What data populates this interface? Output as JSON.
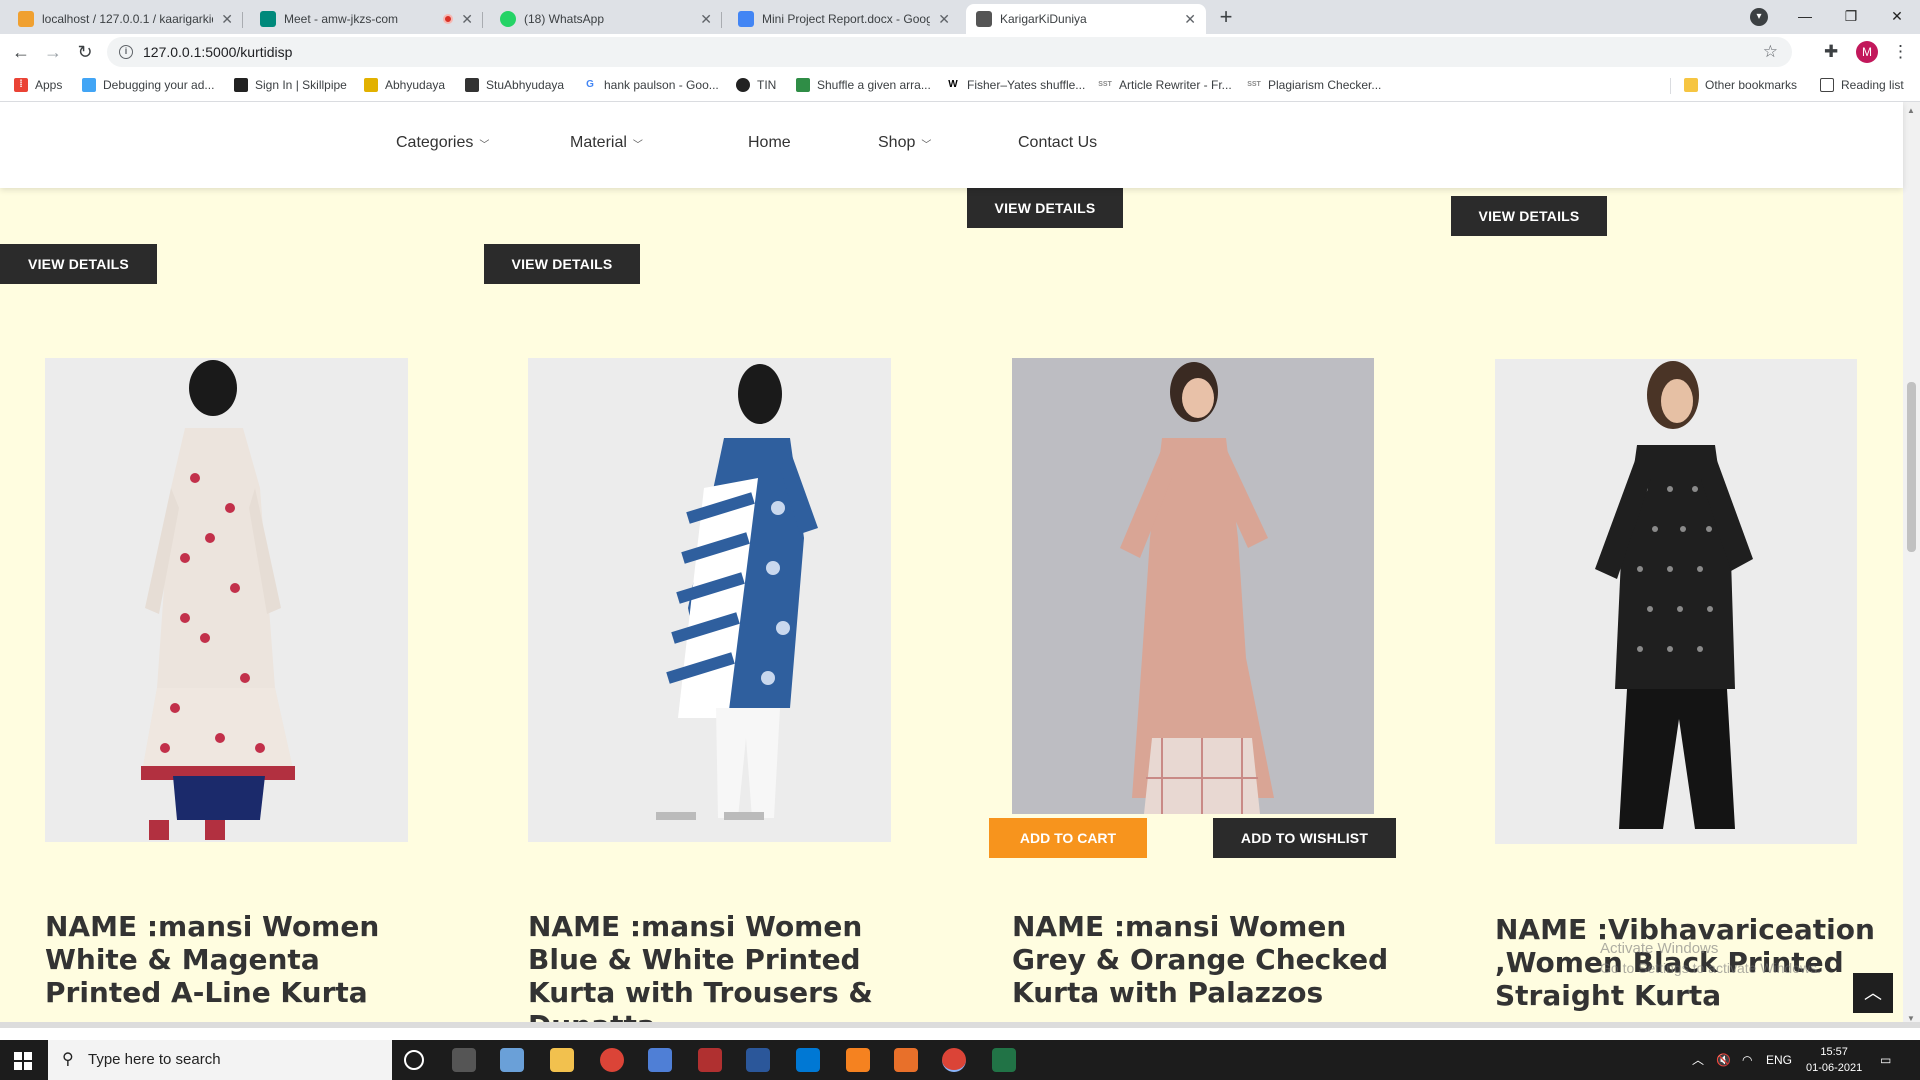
{
  "browser": {
    "tabs": [
      {
        "title": "localhost / 127.0.0.1 / kaarigarkiduniya",
        "favicon_color": "#f0a030"
      },
      {
        "title": "Meet - amw-jkzs-com",
        "favicon_color": "#00897b"
      },
      {
        "title": "(18) WhatsApp",
        "favicon_color": "#25d366"
      },
      {
        "title": "Mini Project Report.docx - Google Docs",
        "favicon_color": "#4285f4"
      },
      {
        "title": "KarigarKiDuniya",
        "favicon_color": "#555555"
      }
    ],
    "url": "127.0.0.1:5000/kurtidisp",
    "profile_initial": "M",
    "bookmarks": [
      "Apps",
      "Debugging your ad...",
      "Sign In | Skillpipe",
      "Abhyudaya",
      "StuAbhyudaya",
      "hank paulson - Goo...",
      "TIN",
      "Shuffle a given arra...",
      "Fisher–Yates shuffle...",
      "Article Rewriter - Fr...",
      "Plagiarism Checker..."
    ],
    "other_bookmarks": "Other bookmarks",
    "reading_list": "Reading list"
  },
  "site_nav": {
    "items": [
      {
        "label": "Categories",
        "dropdown": true
      },
      {
        "label": "Material",
        "dropdown": true
      },
      {
        "label": "Home",
        "dropdown": false
      },
      {
        "label": "Shop",
        "dropdown": true
      },
      {
        "label": "Contact Us",
        "dropdown": false
      }
    ]
  },
  "view_details_label": "VIEW DETAILS",
  "add_to_cart_label": "ADD TO CART",
  "add_to_wishlist_label": "ADD TO WISHLIST",
  "products": [
    {
      "name": "NAME :mansi Women White & Magenta Printed A-Line Kurta",
      "garment_color": "#e9e2dc",
      "accent_color": "#c2304a"
    },
    {
      "name": "NAME :mansi Women Blue & White Printed Kurta with Trousers & Dupatta",
      "garment_color": "#2f5f9e",
      "accent_color": "#ffffff"
    },
    {
      "name": "NAME :mansi Women Grey & Orange Checked Kurta with Palazzos",
      "garment_color": "#d9a595",
      "accent_color": "#e8c8c0"
    },
    {
      "name": "NAME :Vibhavariceation ,Women Black Printed Straight Kurta",
      "garment_color": "#1f1f1f",
      "accent_color": "#8a8a8a"
    }
  ],
  "windows_watermark": {
    "title": "Activate Windows",
    "subtitle": "Go to Settings to activate Windows."
  },
  "taskbar": {
    "search_placeholder": "Type here to search",
    "language": "ENG",
    "time": "15:57",
    "date": "01-06-2021"
  }
}
